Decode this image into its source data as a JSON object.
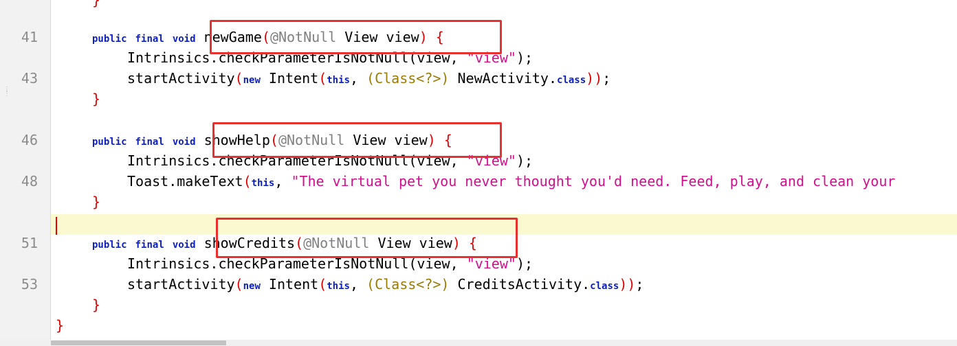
{
  "gutter": {
    "line_numbers": [
      "41",
      "43",
      "46",
      "48",
      "51",
      "53"
    ]
  },
  "code": {
    "l0": {
      "brace": "}"
    },
    "l41": {
      "kw1": "public",
      "kw2": "final",
      "kw3": "void",
      "name": "newGame",
      "open": "(",
      "ann": "@NotNull",
      "params": " View view",
      "close": ")",
      "brace": " {"
    },
    "l42": {
      "text": "Intrinsics.checkParameterIsNotNull(view, ",
      "str": "\"view\"",
      "end": ");"
    },
    "l43": {
      "method": "startActivity",
      "p1": "(",
      "new": "new",
      "intent": " Intent",
      "p2": "(",
      "this": "this",
      "comma": ", ",
      "p3": "(",
      "cls": "Class<?>",
      "p4": ")",
      "target": " NewActivity.",
      "class_kw": "class",
      "p5": "))",
      "semi": ";"
    },
    "l44": {
      "brace": "}"
    },
    "l46": {
      "kw1": "public",
      "kw2": "final",
      "kw3": "void",
      "name": "showHelp",
      "open": "(",
      "ann": "@NotNull",
      "params": " View view",
      "close": ")",
      "brace": " {"
    },
    "l47": {
      "text": "Intrinsics.checkParameterIsNotNull(view, ",
      "str": "\"view\"",
      "end": ");"
    },
    "l48": {
      "text": "Toast.makeText",
      "p1": "(",
      "this": "this",
      "comma": ", ",
      "str": "\"The virtual pet you never thought you'd need. Feed, play, and clean your"
    },
    "l49": {
      "brace": "}"
    },
    "l51": {
      "kw1": "public",
      "kw2": "final",
      "kw3": "void",
      "name": "showCredits",
      "open": "(",
      "ann": "@NotNull",
      "params": " View view",
      "close": ")",
      "brace": " {"
    },
    "l52": {
      "text": "Intrinsics.checkParameterIsNotNull(view, ",
      "str": "\"view\"",
      "end": ");"
    },
    "l53": {
      "method": "startActivity",
      "p1": "(",
      "new": "new",
      "intent": " Intent",
      "p2": "(",
      "this": "this",
      "comma": ", ",
      "p3": "(",
      "cls": "Class<?>",
      "p4": ")",
      "target": " CreditsActivity.",
      "class_kw": "class",
      "p5": "))",
      "semi": ";"
    },
    "l54": {
      "brace": "}"
    },
    "l55": {
      "brace": "}"
    }
  },
  "colors": {
    "keyword": "#0b1fc4",
    "string": "#d10f8e",
    "annotation": "#808080",
    "class_ref": "#9a7b00",
    "highlight_box": "#e8302f",
    "current_line": "#fbf9cf"
  }
}
